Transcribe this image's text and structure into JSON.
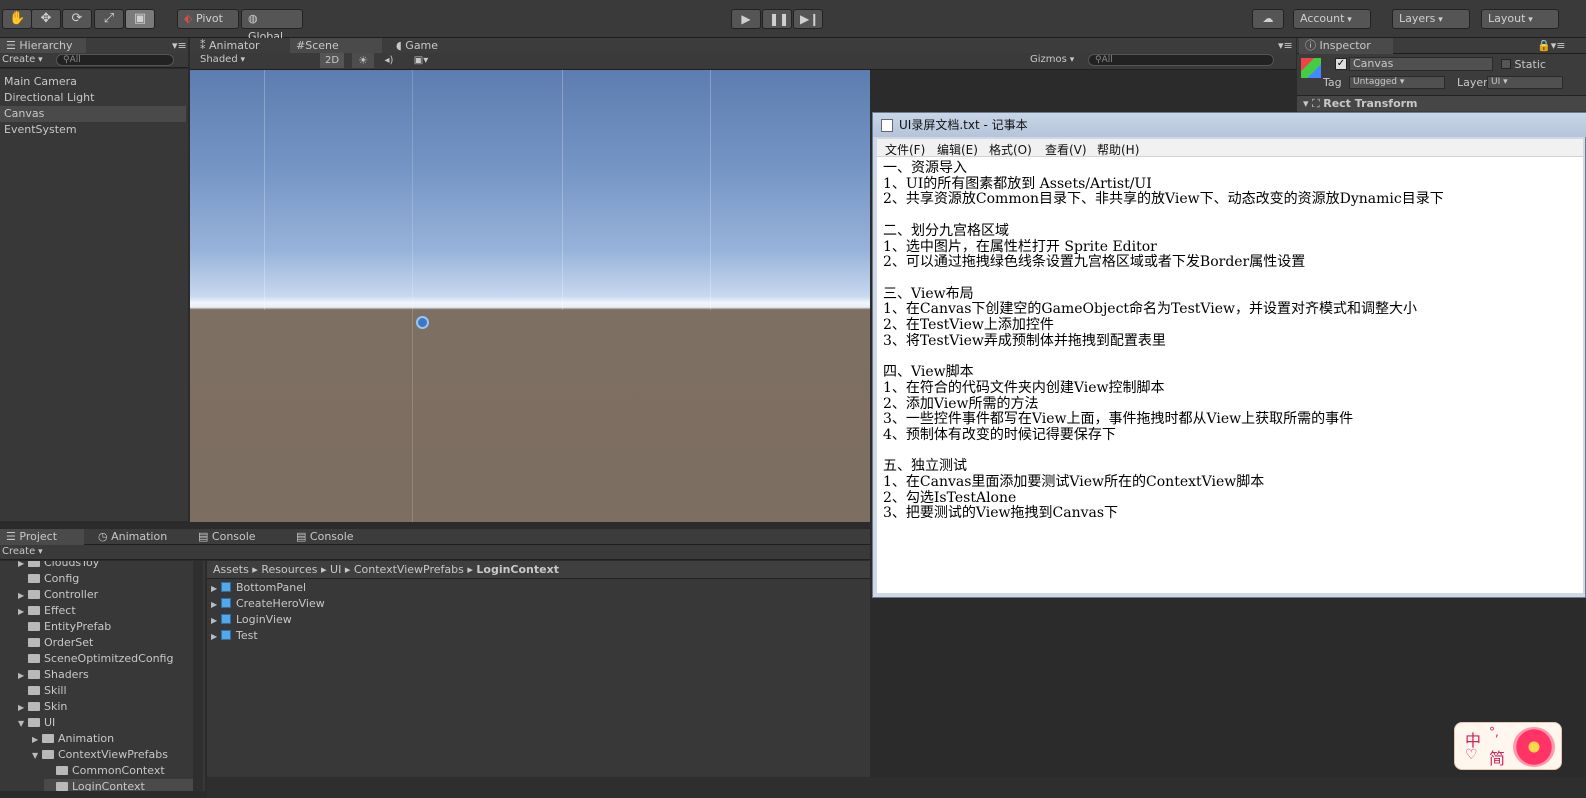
{
  "toolbar": {
    "pivot": "Pivot",
    "global": "Global",
    "account": "Account",
    "layers": "Layers",
    "layout": "Layout"
  },
  "hierarchy": {
    "tab": "Hierarchy",
    "create": "Create",
    "search": "All",
    "items": [
      "Main Camera",
      "Directional Light",
      "Canvas",
      "EventSystem"
    ]
  },
  "scene": {
    "tabs": [
      "Animator",
      "Scene",
      "Game"
    ],
    "shading": "Shaded",
    "mode2d": "2D",
    "gizmos": "Gizmos",
    "search": "All"
  },
  "inspector": {
    "tab": "Inspector",
    "object_name": "Canvas",
    "static": "Static",
    "tag_label": "Tag",
    "tag_value": "Untagged",
    "layer_label": "Layer",
    "layer_value": "UI",
    "component": "Rect Transform"
  },
  "project": {
    "tabs": [
      "Project",
      "Animation",
      "Console",
      "Console"
    ],
    "create": "Create",
    "breadcrumb": [
      "Assets",
      "Resources",
      "UI",
      "ContextViewPrefabs",
      "LoginContext"
    ],
    "tree": [
      "CloudsToy",
      "Config",
      "Controller",
      "Effect",
      "EntityPrefab",
      "OrderSet",
      "SceneOptimitzedConfig",
      "Shaders",
      "Skill",
      "Skin",
      "UI",
      "Animation",
      "ContextViewPrefabs",
      "CommonContext",
      "LoginContext"
    ],
    "assets": [
      "BottomPanel",
      "CreateHeroView",
      "LoginView",
      "Test"
    ]
  },
  "notepad": {
    "title": "UI录屏文档.txt - 记事本",
    "menu": [
      "文件(F)",
      "编辑(E)",
      "格式(O)",
      "查看(V)",
      "帮助(H)"
    ],
    "lines": [
      "一、资源导入",
      "1、UI的所有图素都放到 Assets/Artist/UI",
      "2、共享资源放Common目录下、非共享的放View下、动态改变的资源放Dynamic目录下",
      "",
      "二、划分九宫格区域",
      "1、选中图片，在属性栏打开 Sprite Editor",
      "2、可以通过拖拽绿色线条设置九宫格区域或者下发Border属性设置",
      "",
      "三、View布局",
      "1、在Canvas下创建空的GameObject命名为TestView，并设置对齐模式和调整大小",
      "2、在TestView上添加控件",
      "3、将TestView弄成预制体并拖拽到配置表里",
      "",
      "四、View脚本",
      "1、在符合的代码文件夹内创建View控制脚本",
      "2、添加View所需的方法",
      "3、一些控件事件都写在View上面，事件拖拽时都从View上获取所需的事件",
      "4、预制体有改变的时候记得要保存下",
      "",
      "五、独立测试",
      "1、在Canvas里面添加要测试View所在的ContextView脚本",
      "2、勾选IsTestAlone",
      "3、把要测试的View拖拽到Canvas下"
    ]
  },
  "ime": {
    "lang": "中",
    "punct": "°,",
    "mode": "简"
  }
}
